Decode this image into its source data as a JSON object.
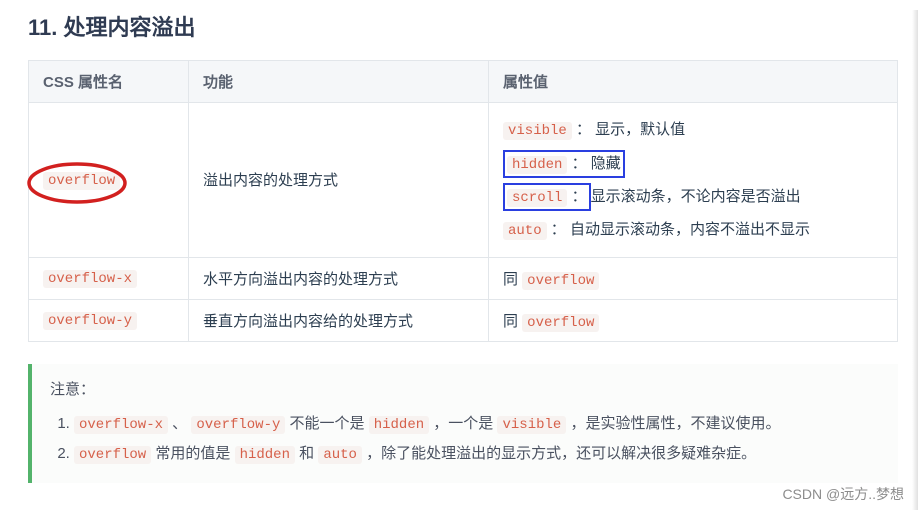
{
  "heading": "11. 处理内容溢出",
  "table": {
    "headers": {
      "prop": "CSS 属性名",
      "func": "功能",
      "val": "属性值"
    },
    "rows": [
      {
        "prop": "overflow",
        "func": "溢出内容的处理方式",
        "values": [
          {
            "code": "visible",
            "sep": "：",
            "desc": "显示，默认值",
            "box": false
          },
          {
            "code": "hidden",
            "sep": "：",
            "desc": "隐藏",
            "box": true
          },
          {
            "code": "scroll",
            "sep": "：",
            "desc": "显示滚动条，不论内容是否溢出",
            "box": true,
            "box_code_only": false,
            "scroll_special": true
          },
          {
            "code": "auto",
            "sep": "：",
            "desc": "自动显示滚动条，内容不溢出不显示",
            "box": false
          }
        ],
        "circled": true
      },
      {
        "prop": "overflow-x",
        "func": "水平方向溢出内容的处理方式",
        "same_as_prefix": "同 ",
        "same_as_code": "overflow"
      },
      {
        "prop": "overflow-y",
        "func": "垂直方向溢出内容给的处理方式",
        "same_as_prefix": "同 ",
        "same_as_code": "overflow"
      }
    ]
  },
  "note": {
    "title": "注意：",
    "items": [
      {
        "parts": [
          {
            "t": "code",
            "v": "overflow-x"
          },
          {
            "t": "text",
            "v": " 、 "
          },
          {
            "t": "code",
            "v": "overflow-y"
          },
          {
            "t": "text",
            "v": " 不能一个是 "
          },
          {
            "t": "code",
            "v": "hidden"
          },
          {
            "t": "text",
            "v": " ，一个是 "
          },
          {
            "t": "code",
            "v": "visible"
          },
          {
            "t": "text",
            "v": " ，是实验性属性，不建议使用。"
          }
        ]
      },
      {
        "parts": [
          {
            "t": "code",
            "v": "overflow"
          },
          {
            "t": "text",
            "v": " 常用的值是 "
          },
          {
            "t": "code",
            "v": "hidden"
          },
          {
            "t": "text",
            "v": " 和 "
          },
          {
            "t": "code",
            "v": "auto"
          },
          {
            "t": "text",
            "v": " ，除了能处理溢出的显示方式，还可以解决很多疑难杂症。"
          }
        ]
      }
    ]
  },
  "watermark": "CSDN @远方..梦想"
}
